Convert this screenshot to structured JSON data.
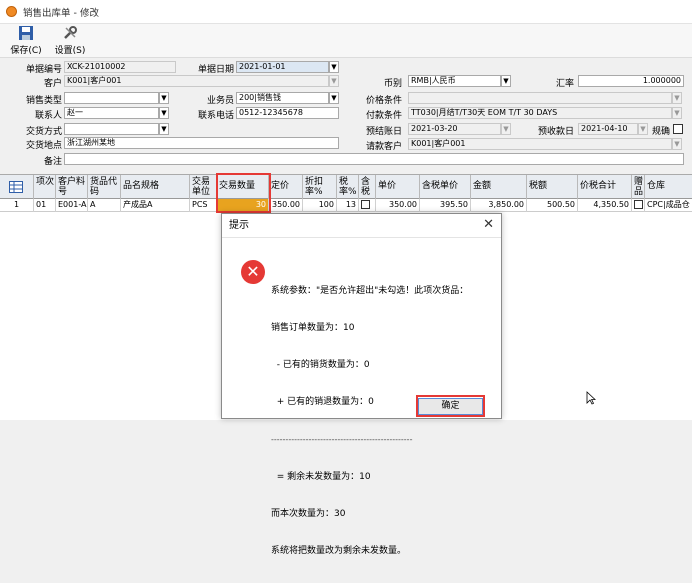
{
  "window": {
    "title": "销售出库单 - 修改"
  },
  "toolbar": {
    "save_label": "保存(C)",
    "settings_label": "设置(S)"
  },
  "form": {
    "doc_no_label": "单据编号",
    "doc_no": "XCK-21010002",
    "doc_date_label": "单据日期",
    "doc_date": "2021-01-01",
    "customer_label": "客户",
    "customer": "K001|客户001",
    "currency_label": "币别",
    "currency": "RMB|人民币",
    "rate_label": "汇率",
    "rate": "1.000000",
    "sales_type_label": "销售类型",
    "sales_type": "",
    "salesman_label": "业务员",
    "salesman": "200|销售钱",
    "price_cond_label": "价格条件",
    "price_cond": "",
    "contact_label": "联系人",
    "contact": "赵一",
    "contact_phone_label": "联系电话",
    "contact_phone": "0512-12345678",
    "pay_cond_label": "付款条件",
    "pay_cond": "TT030|月结T/T30天 EOM T/T 30 DAYS",
    "delivery_method_label": "交货方式",
    "delivery_method": "",
    "est_account_date_label": "预结账日",
    "est_account_date": "2021-03-20",
    "est_receipt_date_label": "预收款日",
    "est_receipt_date": "2021-04-10",
    "spec_label": "规确",
    "delivery_place_label": "交货地点",
    "delivery_place": "浙江湖州某地",
    "bill_customer_label": "请款客户",
    "bill_customer": "K001|客户001",
    "remark_label": "备注",
    "remark": ""
  },
  "grid": {
    "columns": [
      "项次",
      "客户料号",
      "货品代码",
      "品名规格",
      "交易单位",
      "交易数量",
      "定价",
      "折扣率%",
      "税率%",
      "含税",
      "单价",
      "含税单价",
      "金额",
      "税额",
      "价税合计",
      "赠品",
      "仓库"
    ],
    "rows": [
      {
        "row_no": "1",
        "seq": "01",
        "cust_part": "E001-A",
        "item_code": "A",
        "name_spec": "产成品A",
        "unit": "PCS",
        "qty": "30",
        "list_price": "350.00",
        "discount": "100",
        "tax_rate": "13",
        "unit_price": "350.00",
        "tax_unit_price": "395.50",
        "amount": "3,850.00",
        "tax": "500.50",
        "total": "4,350.50",
        "warehouse": "CPC|成品仓"
      }
    ]
  },
  "dialog": {
    "title": "提示",
    "message_lines": [
      "系统参数：\"是否允许超出\"未勾选！此项次货品：",
      "销售订单数量为：10",
      "  - 已有的销货数量为：0",
      "  + 已有的销退数量为：0",
      "-------------------------------------------------",
      "  = 剩余未发数量为：10",
      "而本次数量为：30",
      "系统将把数量改为剩余未发数量。"
    ],
    "ok_label": "确定"
  },
  "colors": {
    "accent": "#e53935",
    "selected_cell": "#e8a31f"
  },
  "icons": [
    "app-icon",
    "save-icon",
    "settings-icon",
    "error-icon",
    "close-icon",
    "grid-menu-icon",
    "cursor-icon"
  ]
}
